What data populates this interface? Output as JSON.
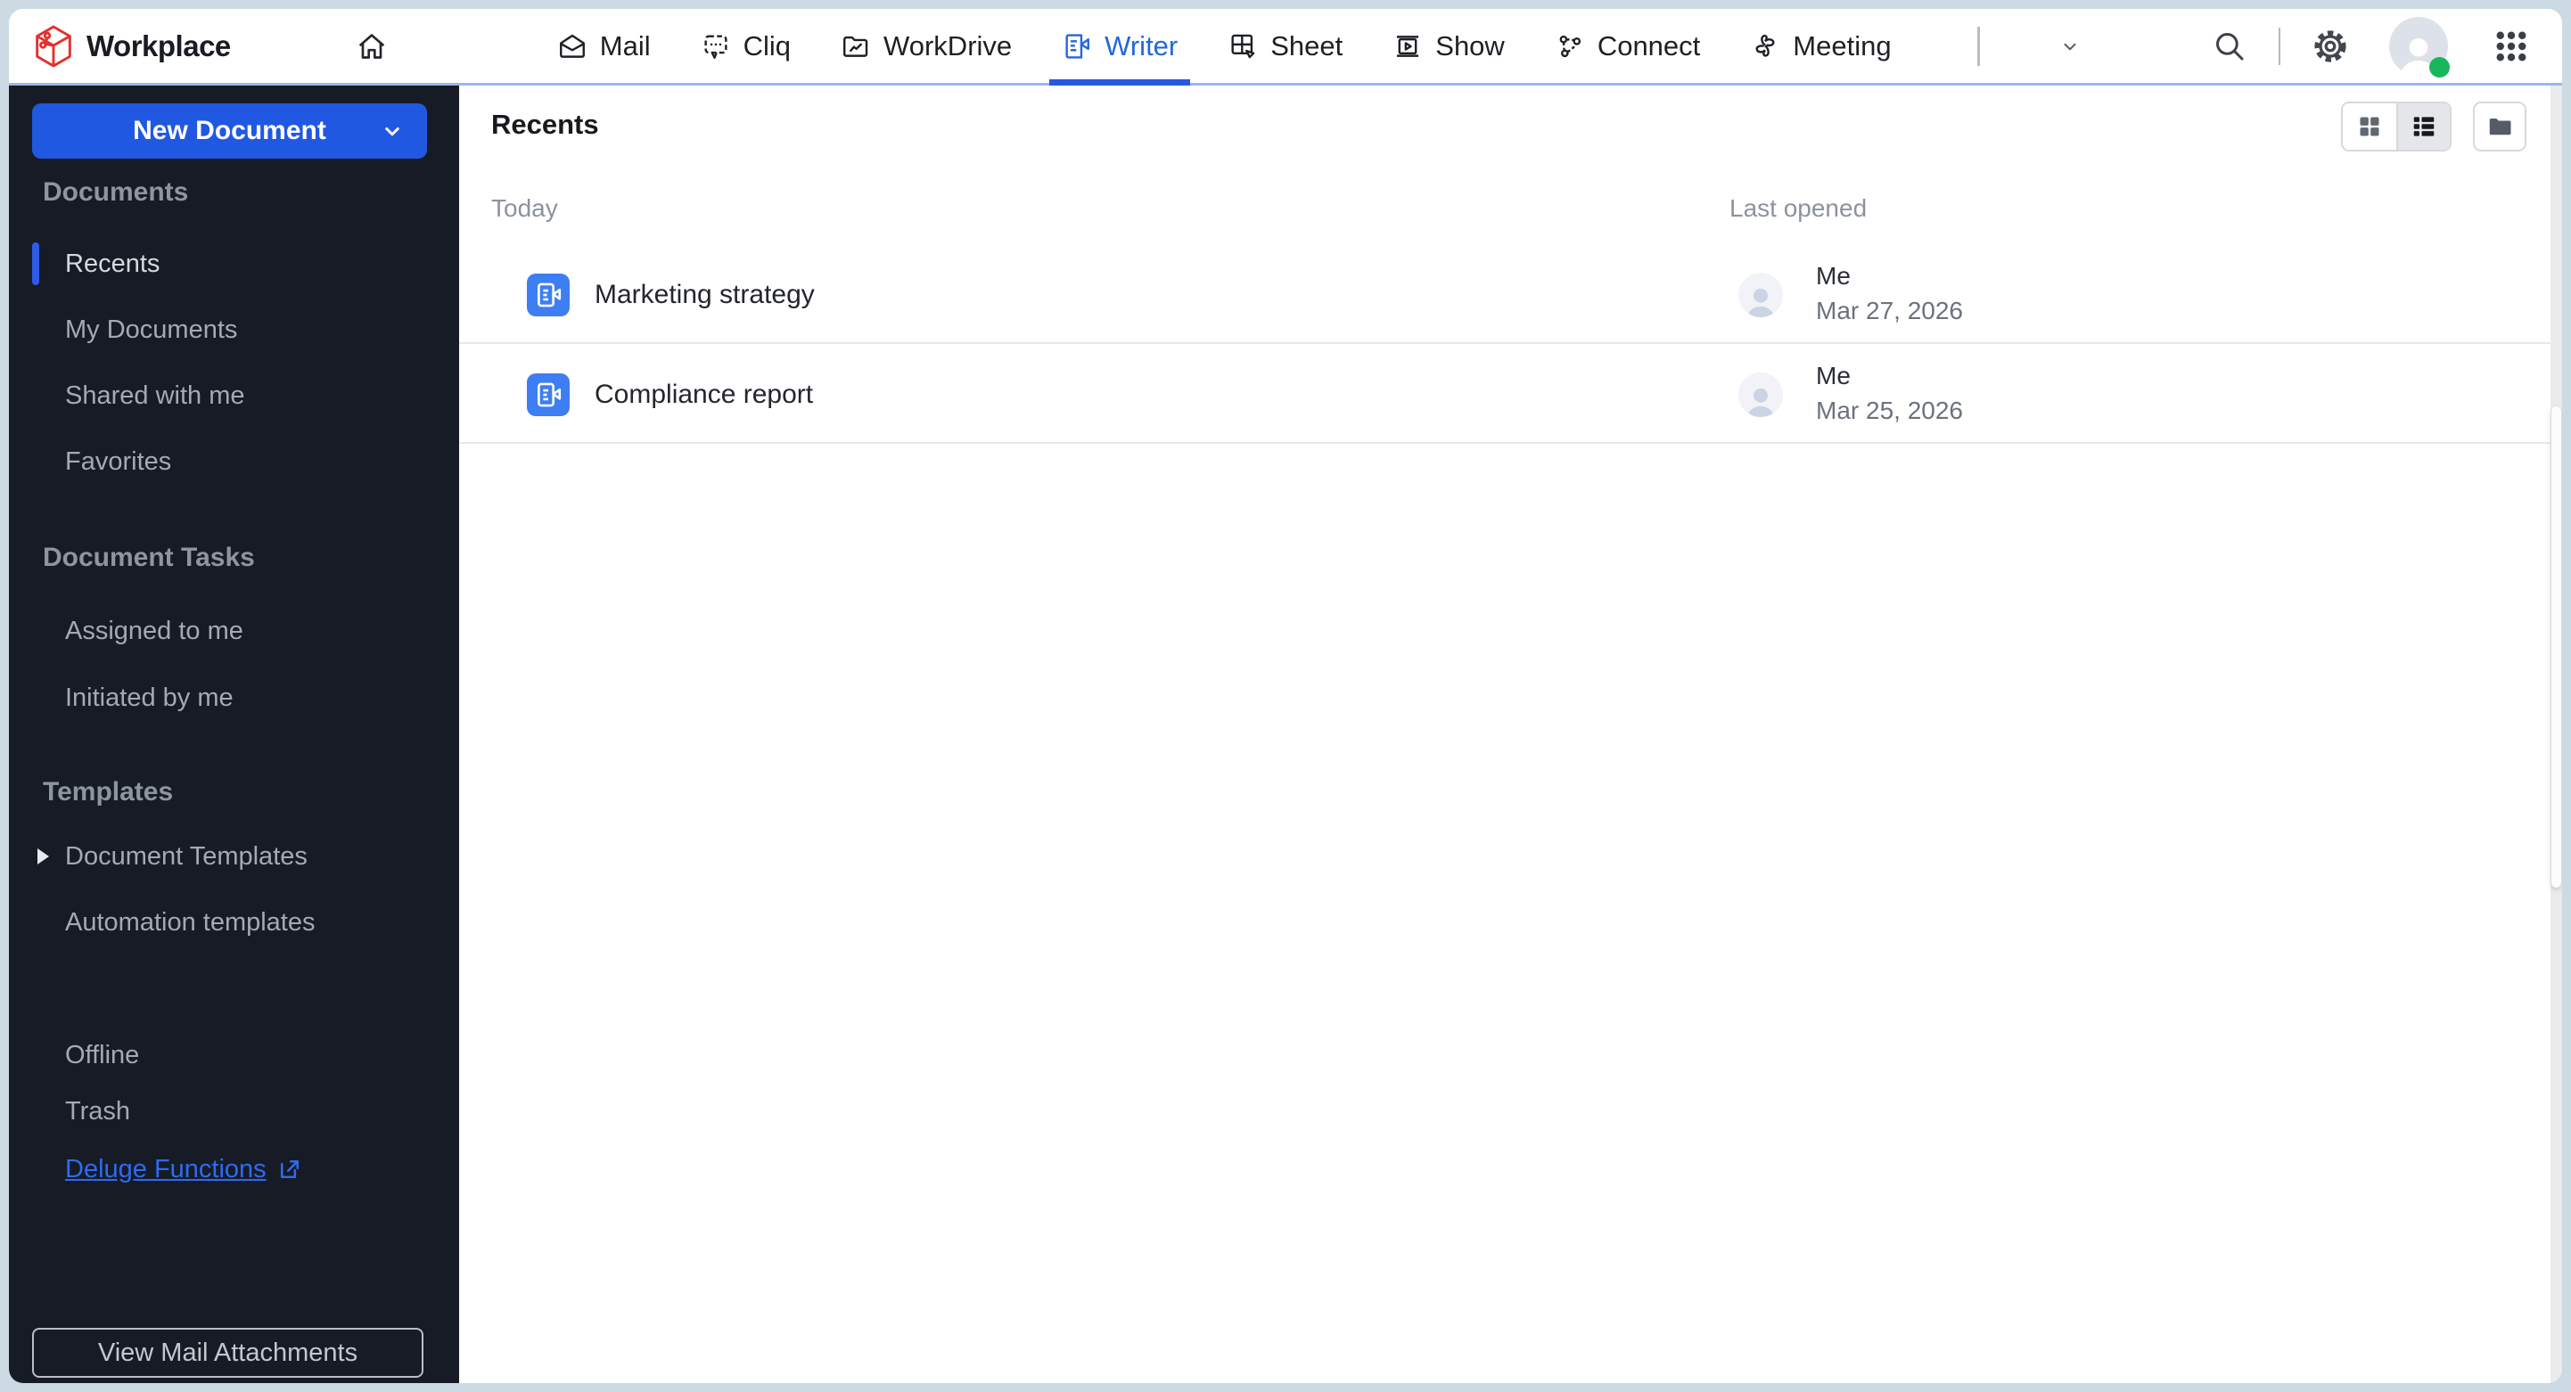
{
  "colors": {
    "frame": "#cbdae3",
    "header_divider": "#9fb4ea",
    "accent_blue": "#2158e1",
    "active_tab_blue": "#2367dc",
    "tab_underline_blue": "#2857e4",
    "doc_icon_blue": "#3d7ef2",
    "link_blue": "#2e6af3",
    "online_green": "#17b75c",
    "sidebar_bg": "#161b25"
  },
  "header": {
    "brand": "Workplace",
    "logo_icon": "zoho-cube-logo",
    "home_icon": "home-icon",
    "nav": [
      {
        "label": "Mail",
        "icon": "mail-icon",
        "active": false
      },
      {
        "label": "Cliq",
        "icon": "cliq-icon",
        "active": false
      },
      {
        "label": "WorkDrive",
        "icon": "workdrive-icon",
        "active": false
      },
      {
        "label": "Writer",
        "icon": "writer-icon",
        "active": true
      },
      {
        "label": "Sheet",
        "icon": "sheet-icon",
        "active": false
      },
      {
        "label": "Show",
        "icon": "show-icon",
        "active": false
      },
      {
        "label": "Connect",
        "icon": "connect-icon",
        "active": false
      },
      {
        "label": "Meeting",
        "icon": "meeting-icon",
        "active": false
      }
    ],
    "more_icon": "chevron-down-icon",
    "right_icons": [
      "search-icon",
      "settings-gear-icon",
      "user-avatar",
      "apps-grid-icon"
    ],
    "user_status": "online"
  },
  "sidebar": {
    "new_document": "New Document",
    "sections": [
      {
        "title": "Documents",
        "items": [
          {
            "label": "Recents",
            "active": true
          },
          {
            "label": "My Documents",
            "active": false
          },
          {
            "label": "Shared with me",
            "active": false
          },
          {
            "label": "Favorites",
            "active": false
          }
        ]
      },
      {
        "title": "Document Tasks",
        "items": [
          {
            "label": "Assigned to me",
            "active": false
          },
          {
            "label": "Initiated by me",
            "active": false
          }
        ]
      },
      {
        "title": "Templates",
        "items": [
          {
            "label": "Document Templates",
            "active": false,
            "expandable": true
          },
          {
            "label": "Automation templates",
            "active": false
          }
        ]
      }
    ],
    "footer": [
      {
        "label": "Offline"
      },
      {
        "label": "Trash"
      },
      {
        "label": "Deluge Functions",
        "external_link": true
      }
    ],
    "attachments_button": "View Mail Attachments"
  },
  "main": {
    "title": "Recents",
    "group_label": "Today",
    "column_last_opened": "Last opened",
    "view_toggles": [
      "grid-view-icon",
      "list-view-icon",
      "folder-view-icon"
    ],
    "active_view": "list",
    "documents": [
      {
        "name": "Marketing strategy",
        "owner": "Me",
        "opened": "Mar 27, 2026"
      },
      {
        "name": "Compliance report",
        "owner": "Me",
        "opened": "Mar 25, 2026"
      }
    ]
  }
}
